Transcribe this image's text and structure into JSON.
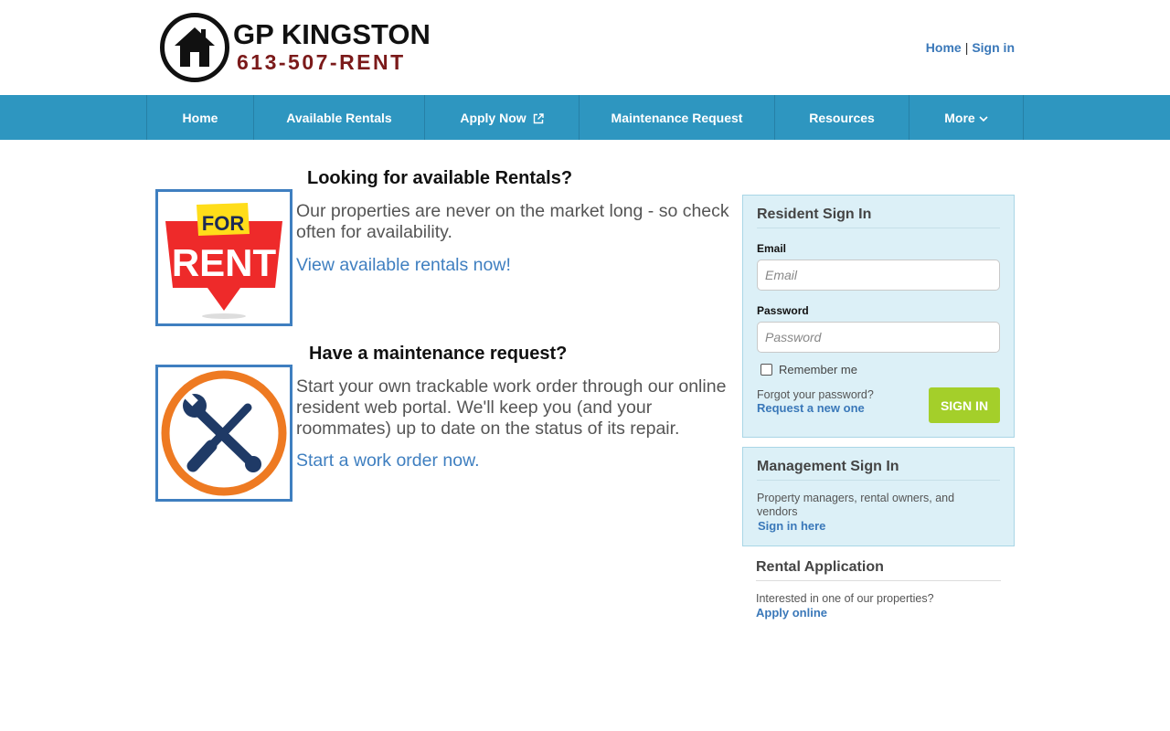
{
  "header": {
    "logo_title": "GP KINGSTON",
    "logo_phone": "613-507-RENT",
    "top_links": {
      "home": "Home",
      "separator": "|",
      "sign_in": "Sign in"
    }
  },
  "nav": {
    "items": [
      {
        "label": "Home"
      },
      {
        "label": "Available Rentals"
      },
      {
        "label": "Apply Now"
      },
      {
        "label": "Maintenance Request"
      },
      {
        "label": "Resources"
      },
      {
        "label": "More"
      }
    ]
  },
  "features": {
    "rentals": {
      "heading": "Looking for available Rentals?",
      "text": "Our properties are never on the market long - so check often for availability.",
      "link": "View available rentals now!",
      "image_top": "FOR",
      "image_bottom": "RENT"
    },
    "maintenance": {
      "heading": "Have a maintenance request?",
      "text": "Start your own trackable work order through our online resident web portal. We'll keep you (and your roommates) up to date on the status of its repair.",
      "link": "Start a work order now."
    }
  },
  "resident_signin": {
    "title": "Resident Sign In",
    "email_label": "Email",
    "email_placeholder": "Email",
    "password_label": "Password",
    "password_placeholder": "Password",
    "remember_label": "Remember me",
    "forgot_text": "Forgot your password?",
    "request_link": "Request a new one",
    "signin_button": "SIGN IN"
  },
  "management_signin": {
    "title": "Management Sign In",
    "text": "Property managers, rental owners, and vendors",
    "link": "Sign in here"
  },
  "rental_application": {
    "title": "Rental Application",
    "text": "Interested in one of our properties?",
    "link": "Apply online"
  },
  "colors": {
    "nav_bg": "#2e96c0",
    "link": "#3a78b9",
    "sign_in_button": "#a4cf2a",
    "panel_bg": "#dcf0f7",
    "phone": "#7b1a1a"
  }
}
